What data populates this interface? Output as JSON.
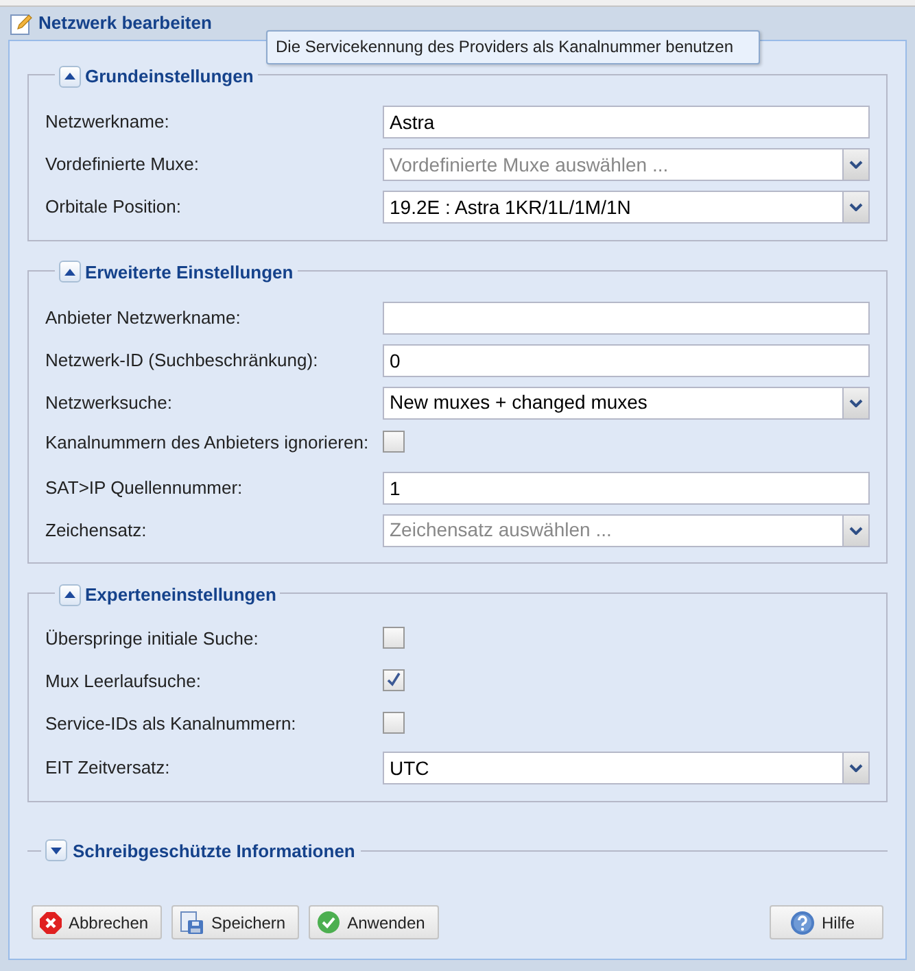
{
  "window": {
    "title": "Netzwerk bearbeiten"
  },
  "tooltip": {
    "text": "Die Servicekennung des Providers als Kanalnummer benutzen"
  },
  "sections": [
    {
      "title": "Grundeinstellungen",
      "expanded": true,
      "fields": [
        {
          "kind": "text",
          "label": "Netzwerkname:",
          "value": "Astra"
        },
        {
          "kind": "combo",
          "label": "Vordefinierte Muxe:",
          "placeholder": "Vordefinierte Muxe auswählen ..."
        },
        {
          "kind": "combo",
          "label": "Orbitale Position:",
          "value": "19.2E : Astra 1KR/1L/1M/1N"
        }
      ]
    },
    {
      "title": "Erweiterte Einstellungen",
      "expanded": true,
      "fields": [
        {
          "kind": "text",
          "label": "Anbieter Netzwerkname:"
        },
        {
          "kind": "text",
          "label": "Netzwerk-ID (Suchbeschränkung):",
          "value": "0"
        },
        {
          "kind": "combo",
          "label": "Netzwerksuche:",
          "value": "New muxes + changed muxes"
        },
        {
          "kind": "checkbox",
          "label": "Kanalnummern des Anbieters ignorieren:",
          "checked": false
        },
        {
          "kind": "text",
          "label": "SAT>IP Quellennummer:",
          "value": "1"
        },
        {
          "kind": "combo",
          "label": "Zeichensatz:",
          "placeholder": "Zeichensatz auswählen ..."
        }
      ]
    },
    {
      "title": "Experteneinstellungen",
      "expanded": true,
      "fields": [
        {
          "kind": "checkbox",
          "label": "Überspringe initiale Suche:",
          "checked": false
        },
        {
          "kind": "checkbox",
          "label": "Mux Leerlaufsuche:",
          "checked": true
        },
        {
          "kind": "checkbox",
          "label": "Service-IDs als Kanalnummern:",
          "checked": false
        },
        {
          "kind": "combo",
          "label": "EIT Zeitversatz:",
          "value": "UTC"
        }
      ]
    },
    {
      "title": "Schreibgeschützte Informationen",
      "expanded": false
    }
  ],
  "buttons": [
    {
      "kind": "cancel",
      "label": "Abbrechen"
    },
    {
      "kind": "save",
      "label": "Speichern"
    },
    {
      "kind": "apply",
      "label": "Anwenden"
    },
    {
      "kind": "help",
      "label": "Hilfe"
    }
  ]
}
